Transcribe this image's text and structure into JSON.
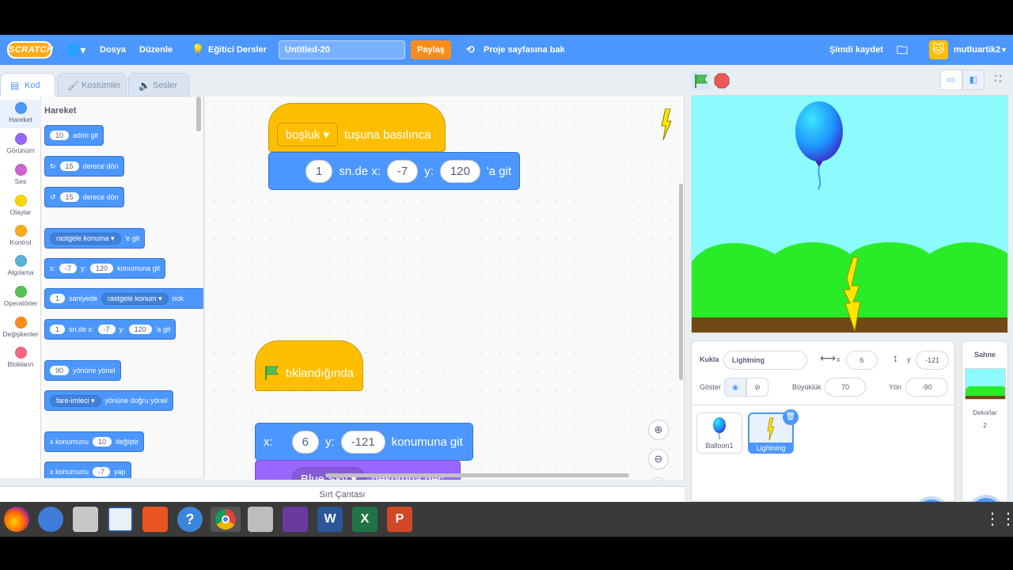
{
  "menubar": {
    "logo": "SCRATCH",
    "file": "Dosya",
    "edit": "Düzenle",
    "tutorials": "Eğitici Dersler",
    "project_title": "Untitled-20",
    "share": "Paylaş",
    "see_project_page": "Proje sayfasına bak",
    "save_now": "Şimdi kaydet",
    "username": "mutluartik2"
  },
  "tabs": {
    "code": "Kod",
    "costumes": "Kostümler",
    "sounds": "Sesler"
  },
  "categories": [
    {
      "label": "Hareket",
      "color": "#4c97ff"
    },
    {
      "label": "Görünüm",
      "color": "#9966ff"
    },
    {
      "label": "Ses",
      "color": "#cf63cf"
    },
    {
      "label": "Olaylar",
      "color": "#ffd500"
    },
    {
      "label": "Kontrol",
      "color": "#ffab19"
    },
    {
      "label": "Algılama",
      "color": "#5cb1d6"
    },
    {
      "label": "Operatörler",
      "color": "#59c059"
    },
    {
      "label": "Değişkenler",
      "color": "#ff8c1a"
    },
    {
      "label": "Blokların",
      "color": "#ff6680"
    }
  ],
  "palette": {
    "heading": "Hareket",
    "move": {
      "num": "10",
      "text": "adım git"
    },
    "turn_right": {
      "num": "15",
      "text": "derece dön"
    },
    "turn_left": {
      "num": "15",
      "text": "derece dön"
    },
    "goto": {
      "dd": "rastgele konuma",
      "text": "'e git"
    },
    "gotoxy": {
      "x_label": "x:",
      "x": "-7",
      "y_label": "y:",
      "y": "120",
      "text": "konumuna git"
    },
    "glide_to": {
      "num": "1",
      "text1": "saniyede",
      "dd": "rastgele konum",
      "text2": "nok"
    },
    "glide_xy": {
      "num": "1",
      "text1": "sn.de x:",
      "x": "-7",
      "y_label": "y:",
      "y": "120",
      "text2": "'a git"
    },
    "point_dir": {
      "num": "90",
      "text": "yönüne yönel"
    },
    "point_towards": {
      "dd": "fare-imleci",
      "text": "yönüne doğru yönel"
    },
    "change_x": {
      "text1": "x konumunu",
      "num": "10",
      "text2": "değiştir"
    },
    "set_x": {
      "text1": "x konumunu",
      "num": "-7",
      "text2": "yap"
    }
  },
  "workspace": {
    "script1": {
      "key": "boşluk",
      "hat_text": "tuşuna basılınca",
      "glide_secs": "1",
      "glide_text1": "sn.de x:",
      "glide_x": "-7",
      "glide_y_label": "y:",
      "glide_y": "120",
      "glide_text2": "'a git"
    },
    "script2": {
      "hat_text": "tıklandığında",
      "x_label": "x:",
      "x": "6",
      "y_label": "y:",
      "y": "-121",
      "goto_text": "konumuna git",
      "backdrop": "Blue Sky",
      "switch_text": "dekoruna geç"
    }
  },
  "backpack": "Sırt Çantası",
  "sprite_info": {
    "sprite_label": "Kukla",
    "sprite_name": "Lightning",
    "x_label": "x",
    "x": "6",
    "y_label": "y",
    "y": "-121",
    "show_label": "Göster",
    "size_label": "Büyüklük",
    "size": "70",
    "direction_label": "Yön",
    "direction": "-90"
  },
  "sprites": [
    {
      "name": "Balloon1"
    },
    {
      "name": "Lightning"
    }
  ],
  "stage_panel": {
    "title": "Sahne",
    "backdrops_label": "Dekorlar",
    "backdrops_count": "2"
  }
}
